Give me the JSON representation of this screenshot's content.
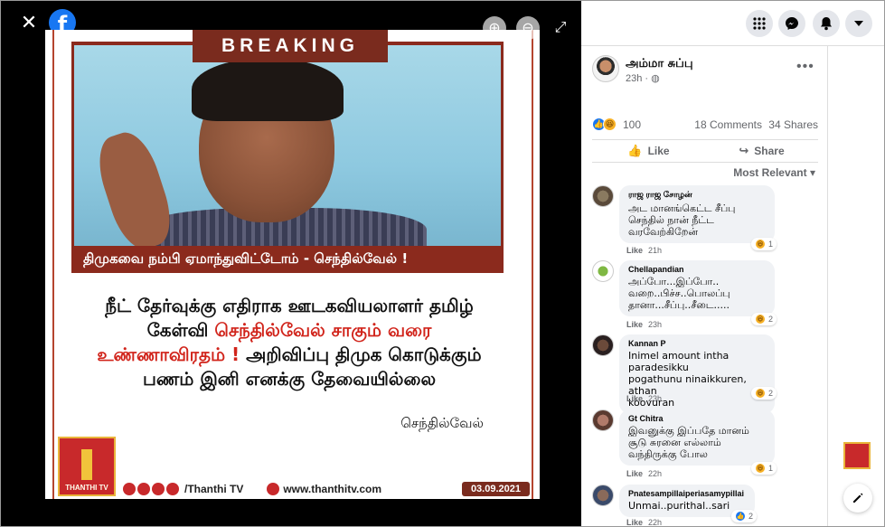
{
  "viewer": {
    "close_glyph": "✕",
    "fb_logo": "f",
    "zoom_in_glyph": "⊕",
    "zoom_out_glyph": "⊖",
    "fullscreen_glyph": "⤢"
  },
  "image_card": {
    "breaking": "BREAKING",
    "video_caption": "திமுகவை நம்பி ஏமாந்துவிட்டோம் - செந்தில்வேல் !",
    "headline_part1": "நீட் தேர்வுக்கு எதிராக ஊடகவியலாளர் தமிழ் கேள்வி ",
    "headline_red1": "செந்தில்வேல்  சாகும் வரை உண்ணாவிரதம் !",
    "headline_part2": " அறிவிப்பு திமுக கொடுக்கும் பணம் இனி எனக்கு தேவையில்லை",
    "byline": "செந்தில்வேல்",
    "logo_text": "THANTHI TV",
    "footer_handle": "/Thanthi TV",
    "footer_web": "www.thanthitv.com",
    "footer_date": "03.09.2021"
  },
  "topbar": {
    "menu_icon": "menu-grid-icon",
    "messenger_icon": "messenger-icon",
    "notifications_icon": "bell-icon",
    "account_icon": "caret-down-icon"
  },
  "post": {
    "author": "அம்மா சுப்பு",
    "time": "23h · ◍",
    "more": "•••",
    "reactions_count": "100",
    "comments_count": "18 Comments",
    "shares_count": "34 Shares",
    "like_label": "Like",
    "share_label": "Share",
    "sort_label": "Most Relevant ▾"
  },
  "comments": [
    {
      "author": "ராஜ ராஜ சோழன்",
      "text": "அட மானங்கெட்ட சீப்பு\nசெந்தில் நான் நீட்ட\nவரவேற்கிறேன்",
      "like": "Like",
      "time": "21h",
      "reactions": "1"
    },
    {
      "author": "Chellapandian",
      "text": "அப்போ...இப்போ..\nவறை..பிச்ச..பொலப்பு\nதானா...சீப்பு..சீடை.....",
      "like": "Like",
      "time": "23h",
      "reactions": "2"
    },
    {
      "author": "Kannan P",
      "text": "Inimel amount intha paradesikku\npogathunu ninaikkuren, athan\nkoovuran",
      "like": "Like",
      "time": "23h",
      "reactions": "2"
    },
    {
      "author": "Gt Chitra",
      "text": "இவனுக்கு இப்பதே மானம்\nசூடு சுரனை எல்லாம்\nவந்திருக்கு போல",
      "like": "Like",
      "time": "22h",
      "reactions": "1"
    },
    {
      "author": "Pnatesampillaiperiasamypillai",
      "text": "Unmai..purithal..sari",
      "like": "Like",
      "time": "22h",
      "reactions": "2"
    }
  ],
  "colors": {
    "facebook_blue": "#1877f2",
    "thanthi_red": "#c8292b",
    "breaking_maroon": "#7a2b1e",
    "headline_red": "#d1241b"
  }
}
